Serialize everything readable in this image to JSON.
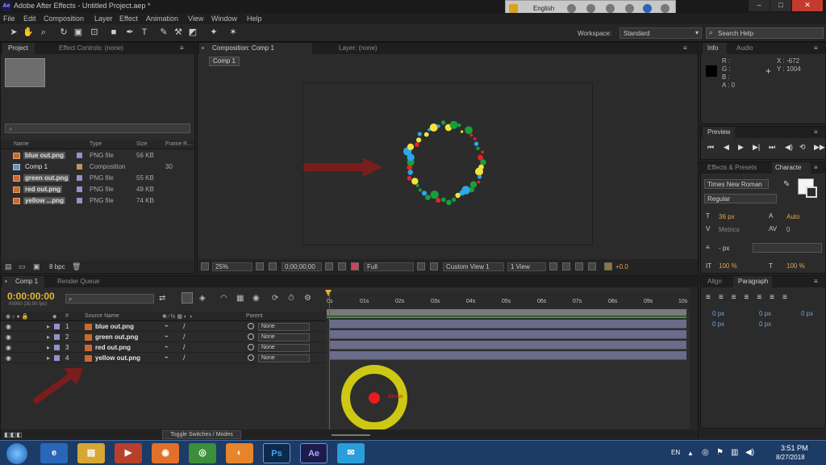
{
  "window": {
    "app_logo": "Ae",
    "title": "Adobe After Effects - Untitled Project.aep *",
    "language": "English",
    "minimize": "–",
    "maximize": "□",
    "close": "✕"
  },
  "menu": [
    "File",
    "Edit",
    "Composition",
    "Layer",
    "Effect",
    "Animation",
    "View",
    "Window",
    "Help"
  ],
  "toolbar": {
    "workspace_label": "Workspace:",
    "workspace_value": "Standard",
    "search_placeholder": "Search Help"
  },
  "project_panel": {
    "tab_project": "Project",
    "tab_effect_controls": "Effect Controls: (none)",
    "search_value": "",
    "columns": [
      "Name",
      "Type",
      "Size",
      "Frame R..."
    ],
    "items": [
      {
        "name": "blue out.png",
        "type": "PNG file",
        "size": "56 KB",
        "frame_rate": ""
      },
      {
        "name": "Comp 1",
        "type": "Composition",
        "size": "",
        "frame_rate": "30"
      },
      {
        "name": "green out.png",
        "type": "PNG file",
        "size": "55 KB",
        "frame_rate": ""
      },
      {
        "name": "red out.png",
        "type": "PNG file",
        "size": "49 KB",
        "frame_rate": ""
      },
      {
        "name": "yellow ...png",
        "type": "PNG file",
        "size": "74 KB",
        "frame_rate": ""
      }
    ],
    "bit_depth": "8 bpc"
  },
  "composition_panel": {
    "tab_composition": "Composition: Comp 1",
    "tab_layer": "Layer: (none)",
    "subtab": "Comp 1",
    "zoom": "25%",
    "timecode": "0;00;00;00",
    "resolution": "Full",
    "view": "Custom View 1",
    "views": "1 View",
    "exposure": "+0.0",
    "circle_colors": [
      "#1a9e3a",
      "#e82424",
      "#f5e33a",
      "#2aa7e8"
    ]
  },
  "info_panel": {
    "tab_info": "Info",
    "tab_audio": "Audio",
    "r": "R :",
    "g": "G :",
    "b": "B :",
    "a": "A : 0",
    "x": "X : -672",
    "y": "Y : 1004"
  },
  "preview_panel": {
    "tab": "Preview"
  },
  "character_panel": {
    "tab_effects": "Effects & Presets",
    "tab_character": "Characte",
    "font": "Times New Roman",
    "style": "Regular",
    "font_size": "36 px",
    "leading": "Auto",
    "kerning": "Metrics",
    "tracking": "0",
    "stroke_width": "- px",
    "vertical_scale": "100 %",
    "horizontal_scale": "100 %"
  },
  "paragraph_panel": {
    "tab_align": "Align",
    "tab_paragraph": "Paragraph",
    "indent_left": "0 px",
    "indent_right": "0 px",
    "indent_first": "0 px",
    "space_before": "0 px",
    "space_after": "0 px"
  },
  "timeline": {
    "tab_comp": "Comp 1",
    "tab_render": "Render Queue",
    "timecode": "0:00:00:00",
    "fps": "00000 (30.00 fps)",
    "columns": {
      "number": "#",
      "source": "Source Name",
      "parent": "Parent"
    },
    "layers": [
      {
        "num": "1",
        "name": "blue out.png",
        "parent": "None"
      },
      {
        "num": "2",
        "name": "green out.png",
        "parent": "None"
      },
      {
        "num": "3",
        "name": "red out.png",
        "parent": "None"
      },
      {
        "num": "4",
        "name": "yellow out.png",
        "parent": "None"
      }
    ],
    "ticks": [
      "0s",
      "01s",
      "02s",
      "03s",
      "04s",
      "05s",
      "06s",
      "07s",
      "08s",
      "09s",
      "10s"
    ],
    "toggle_label": "Toggle Switches / Modes",
    "cursor_label": "Arrow"
  },
  "taskbar": {
    "language": "EN",
    "time": "3:51 PM",
    "date": "8/27/2018",
    "photoshop": "Ps",
    "after_effects": "Ae"
  }
}
